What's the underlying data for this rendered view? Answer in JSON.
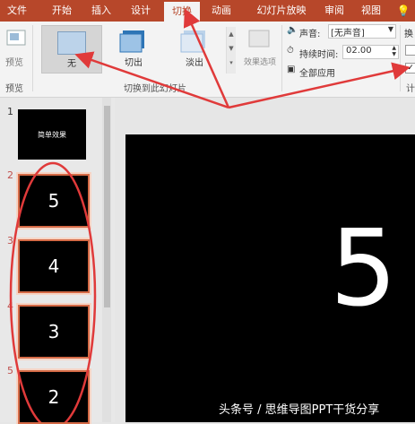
{
  "tabs": [
    "文件",
    "开始",
    "插入",
    "设计",
    "切换",
    "动画",
    "幻灯片放映",
    "审阅",
    "视图"
  ],
  "preview": {
    "label": "预览",
    "group": "预览"
  },
  "transitions": [
    {
      "label": "无"
    },
    {
      "label": "切出"
    },
    {
      "label": "淡出"
    }
  ],
  "effect_options": "效果选项",
  "transition_group": "切换到此幻灯片",
  "timing": {
    "sound_label": "声音:",
    "sound_value": "[无声音]",
    "duration_label": "持续时间:",
    "duration_value": "02.00",
    "apply_all": "全部应用",
    "right_label": "换",
    "right_group": "计"
  },
  "thumbnails": [
    {
      "num": "1",
      "text": "简单效果"
    },
    {
      "num": "2",
      "text": "5"
    },
    {
      "num": "3",
      "text": "4"
    },
    {
      "num": "4",
      "text": "3"
    },
    {
      "num": "5",
      "text": "2"
    }
  ],
  "main_slide": {
    "text": "5"
  },
  "watermark": "头条号 / 思维导图PPT干货分享",
  "colors": {
    "accent": "#b7472a",
    "annotation_red": "#e03a3a"
  }
}
